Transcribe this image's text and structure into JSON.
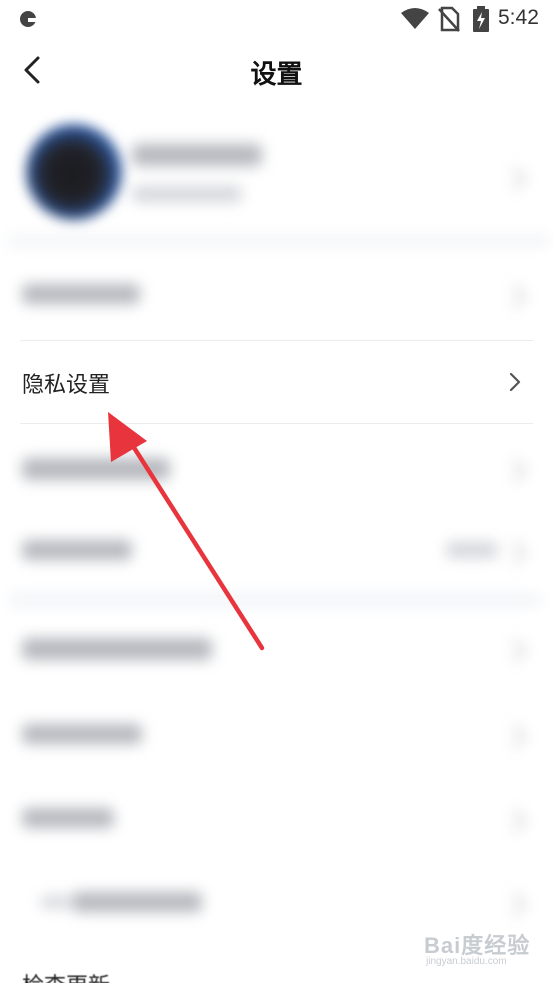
{
  "status_bar": {
    "time": "5:42",
    "icons": [
      "app-notification-icon",
      "wifi-icon",
      "no-sim-icon",
      "battery-charging-icon"
    ]
  },
  "header": {
    "title": "设置",
    "back_icon": "chevron-left-icon"
  },
  "rows": {
    "privacy": {
      "label": "隐私设置",
      "icon": "chevron-right-icon"
    },
    "check_update": {
      "label": "检查更新"
    }
  },
  "annotation": {
    "color": "#e8343c"
  },
  "watermark": {
    "brand": "Bai度经验",
    "url": "jingyan.baidu.com"
  }
}
